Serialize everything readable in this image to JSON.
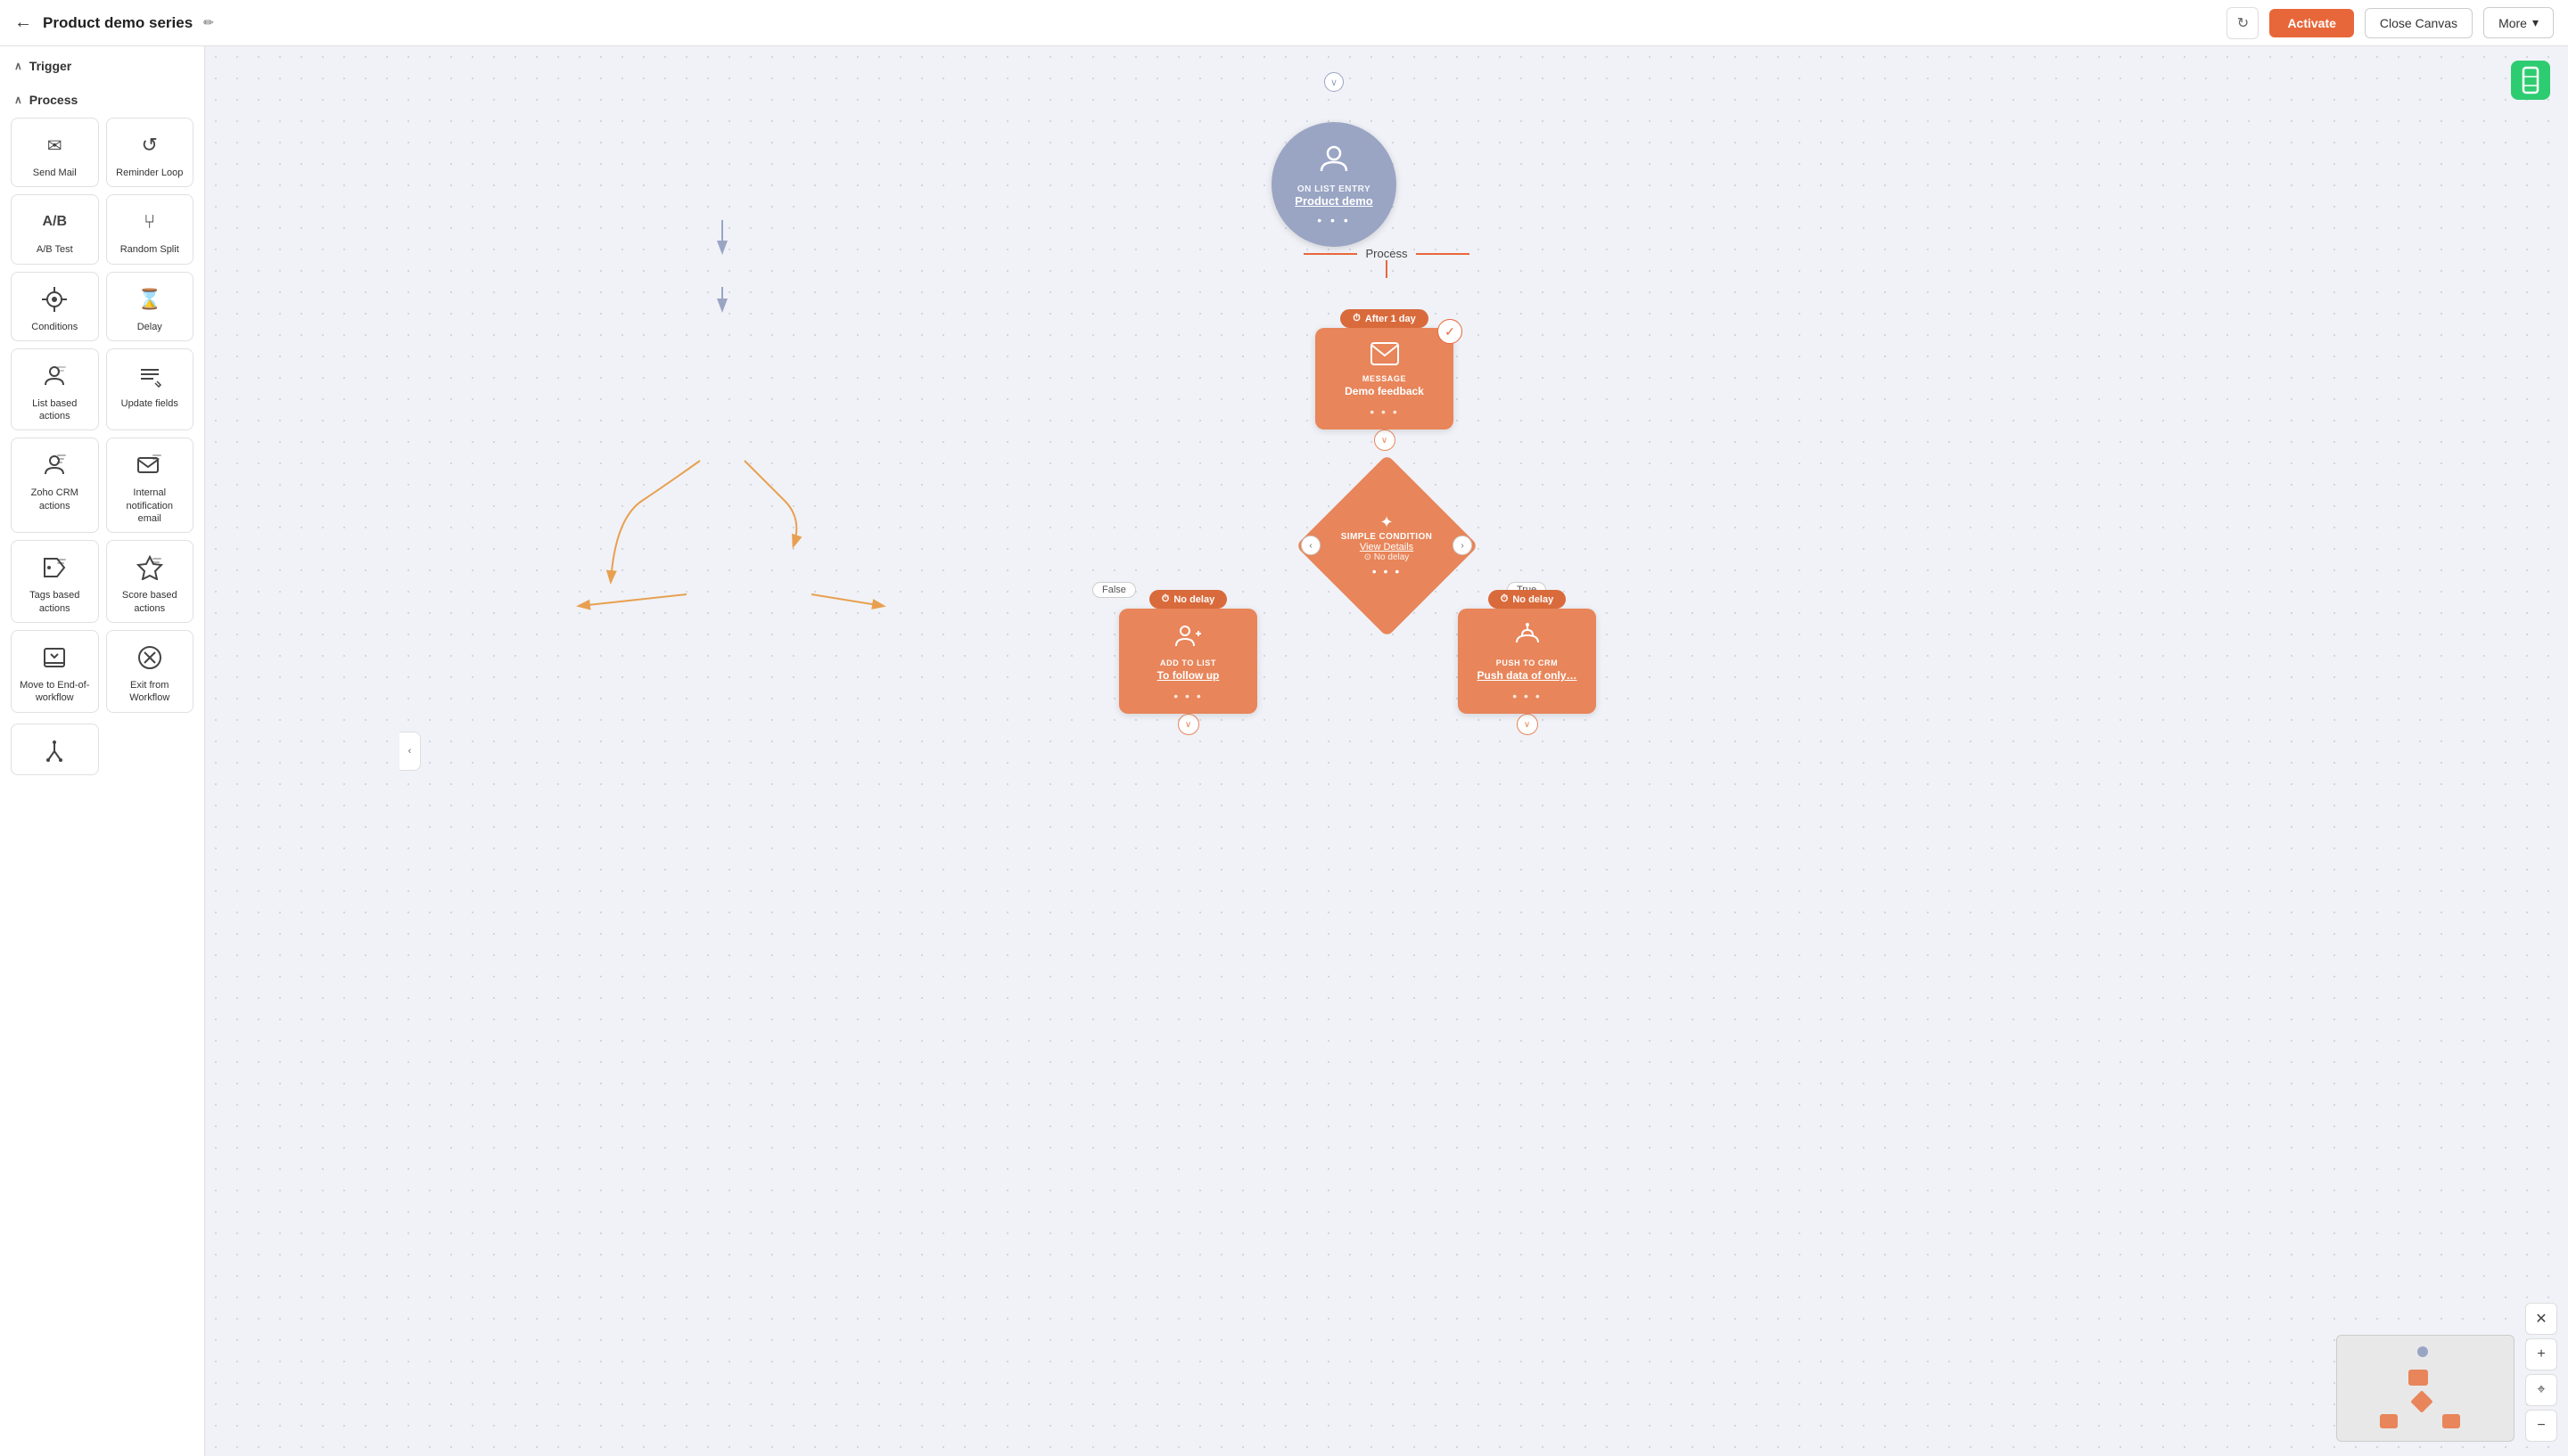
{
  "header": {
    "back_icon": "←",
    "title": "Product demo series",
    "edit_icon": "✏",
    "refresh_icon": "↻",
    "activate_label": "Activate",
    "close_canvas_label": "Close Canvas",
    "more_label": "More",
    "more_chevron": "▾"
  },
  "sidebar": {
    "trigger_section": "Trigger",
    "process_section": "Process",
    "trigger_chevron": "∨",
    "process_chevron": "∨",
    "items": [
      {
        "id": "send-mail",
        "icon": "✉",
        "label": "Send Mail"
      },
      {
        "id": "reminder-loop",
        "icon": "⟳",
        "label": "Reminder Loop"
      },
      {
        "id": "ab-test",
        "icon": "A/B",
        "label": "A/B Test"
      },
      {
        "id": "random-split",
        "icon": "⑂",
        "label": "Random Split"
      },
      {
        "id": "conditions",
        "icon": "✦",
        "label": "Conditions"
      },
      {
        "id": "delay",
        "icon": "⌛",
        "label": "Delay"
      },
      {
        "id": "list-based",
        "icon": "👤",
        "label": "List based actions"
      },
      {
        "id": "update-fields",
        "icon": "☰",
        "label": "Update fields"
      },
      {
        "id": "zoho-crm",
        "icon": "⛶",
        "label": "Zoho CRM actions"
      },
      {
        "id": "internal-email",
        "icon": "✉",
        "label": "Internal notification email"
      },
      {
        "id": "tags-based",
        "icon": "🏷",
        "label": "Tags based actions"
      },
      {
        "id": "score-based",
        "icon": "🏆",
        "label": "Score based actions"
      },
      {
        "id": "move-end",
        "icon": "⊡",
        "label": "Move to End-of-workflow"
      },
      {
        "id": "exit-workflow",
        "icon": "⊗",
        "label": "Exit from Workflow"
      }
    ],
    "single_item": {
      "id": "fork",
      "icon": "⑂",
      "label": ""
    }
  },
  "canvas": {
    "gem_icon": "◈",
    "trigger_node": {
      "icon": "👤",
      "label": "ON LIST ENTRY",
      "name": "Product demo",
      "dots": "• • •"
    },
    "process_label": "Process",
    "msg_node": {
      "delay_label": "After 1 day",
      "delay_icon": "⏱",
      "type_label": "MESSAGE",
      "name": "Demo feedback",
      "dots": "• • •"
    },
    "condition_node": {
      "icon": "✦",
      "label": "Simple Condition",
      "link": "View Details",
      "delay": "⊙ No delay",
      "dots": "• • •",
      "false_label": "False",
      "true_label": "True"
    },
    "false_node": {
      "delay_label": "No delay",
      "delay_icon": "⏱",
      "type_label": "ADD TO LIST",
      "name": "To follow up",
      "dots": "• • •"
    },
    "true_node": {
      "delay_label": "No delay",
      "delay_icon": "⏱",
      "type_label": "PUSH TO CRM",
      "name": "Push data of only…",
      "dots": "• • •"
    }
  },
  "zoom_controls": {
    "close_icon": "✕",
    "zoom_in_icon": "+",
    "reset_icon": "⌖",
    "zoom_out_icon": "−"
  }
}
